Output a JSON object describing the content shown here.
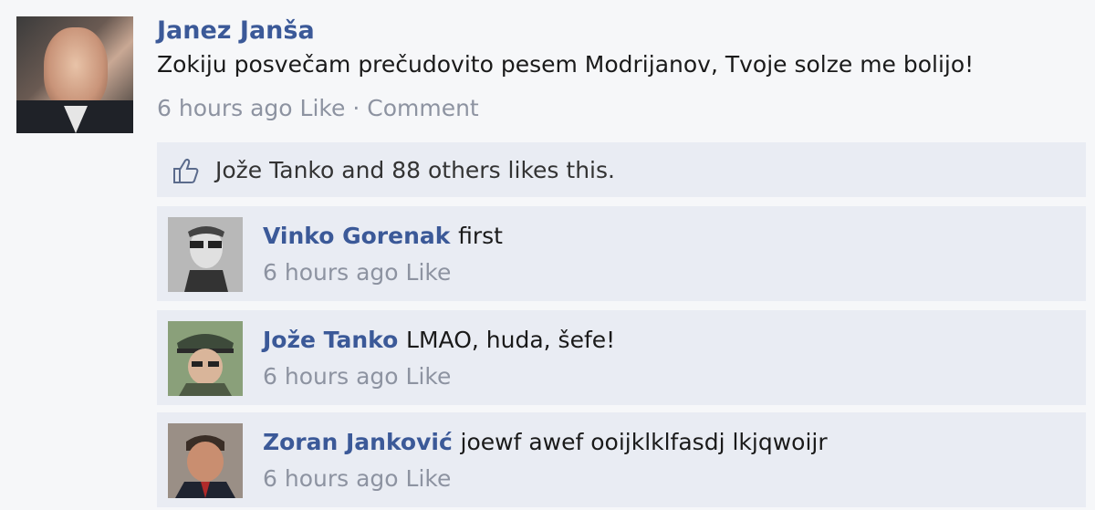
{
  "post": {
    "author": "Janez Janša",
    "text": "Zokiju posvečam prečudovito pesem Modrijanov, Tvoje solze me bolijo!",
    "time": "6 hours ago",
    "like": "Like",
    "separator": "·",
    "comment": "Comment"
  },
  "likes": {
    "icon": "thumbs-up-icon",
    "text": "Jože Tanko and 88 others likes this."
  },
  "comments": [
    {
      "name": "Vinko Gorenak",
      "text": "first",
      "time": "6 hours ago",
      "like": "Like"
    },
    {
      "name": "Jože Tanko",
      "text": "LMAO, huda, šefe!",
      "time": "6 hours ago",
      "like": "Like"
    },
    {
      "name": "Zoran Janković",
      "text": "joewf awef ooijklklfasdj lkjqwoijr",
      "time": "6 hours ago",
      "like": "Like"
    }
  ],
  "colors": {
    "link": "#3b5998",
    "meta": "#8d93a1",
    "panel": "#e9ecf3",
    "background": "#f6f7f9"
  }
}
